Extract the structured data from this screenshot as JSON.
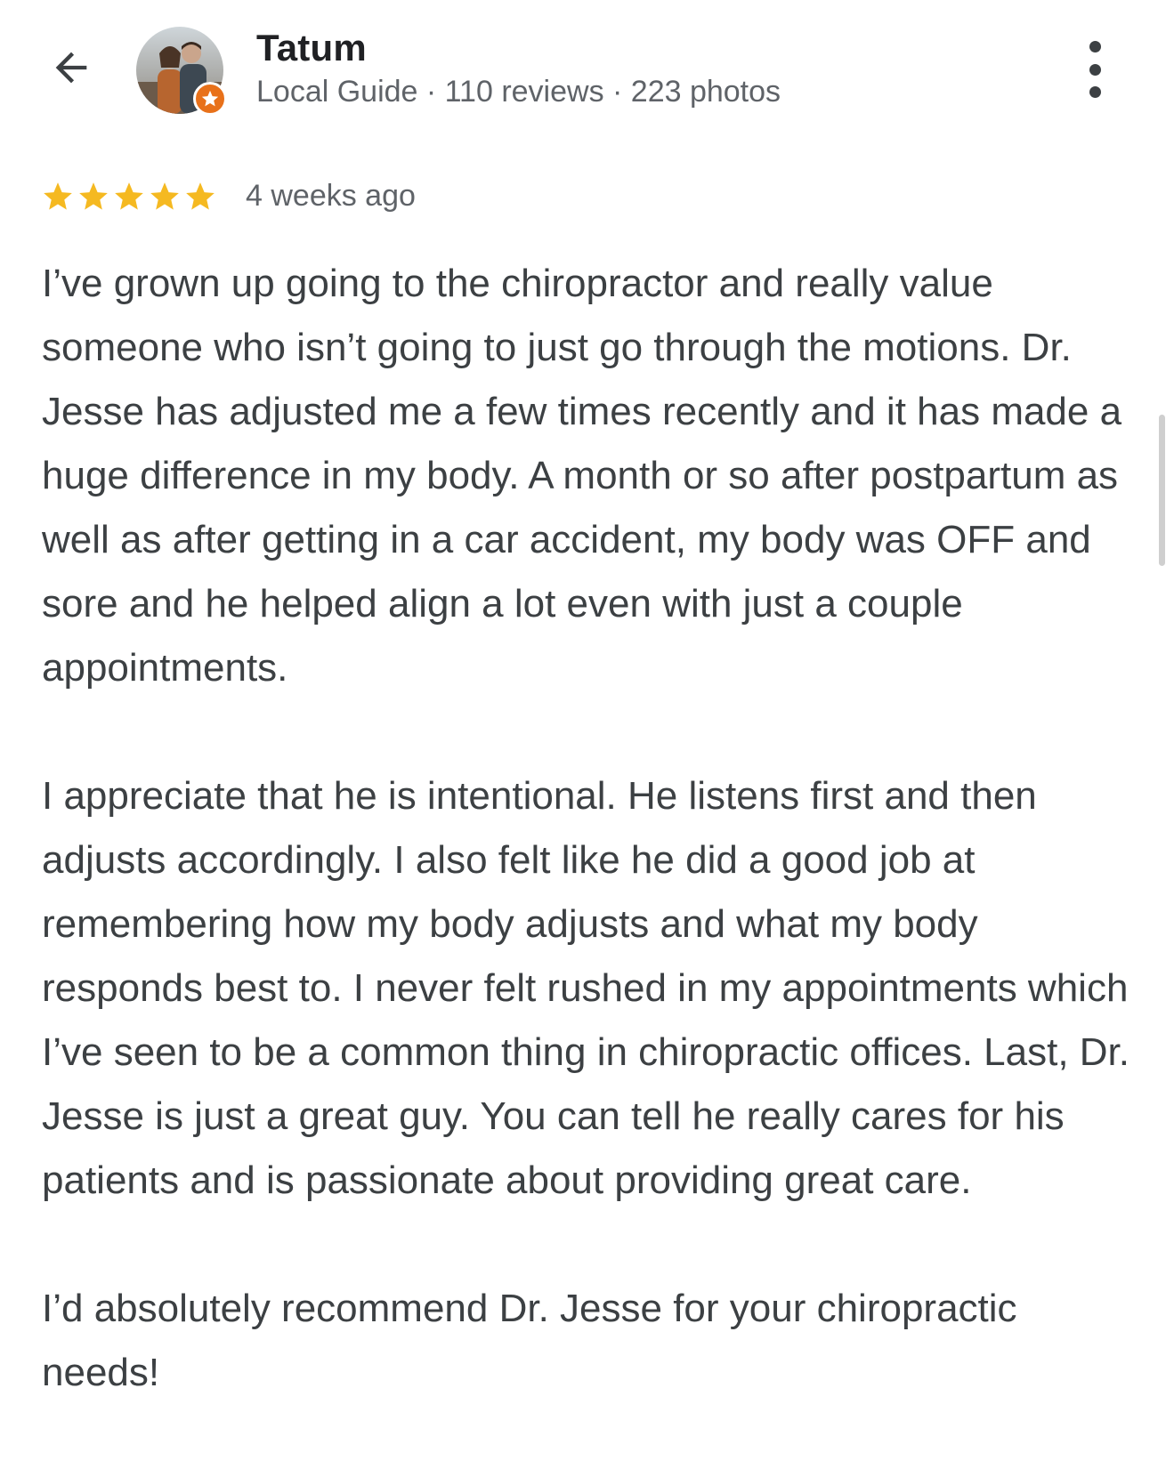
{
  "header": {
    "author_name": "Tatum",
    "author_meta": "Local Guide · 110 reviews · 223 photos",
    "icons": {
      "back": "arrow-back-icon",
      "more": "more-vert-icon",
      "badge": "local-guide-badge-icon"
    }
  },
  "review": {
    "rating": 5,
    "max_rating": 5,
    "time_ago": "4 weeks ago",
    "paragraphs": [
      "I’ve grown up going to the chiropractor and really value someone who isn’t going to just go through the motions. Dr. Jesse has adjusted me a few times recently and it has made a huge difference in my body. A month or so after postpartum as well as after getting in a car accident, my body was OFF and sore and he helped align a lot even with just a couple appointments.",
      "I appreciate that he is intentional. He listens first and then adjusts accordingly. I also felt like he did a good job at remembering how my body adjusts and what my body responds best to. I never felt rushed in my appointments which I’ve seen to be a common thing in chiropractic offices. Last, Dr. Jesse is just a great guy. You can tell he really cares for his patients and is passionate about providing great care.",
      "I’d absolutely recommend Dr. Jesse for your chiropractic needs!"
    ]
  },
  "colors": {
    "star": "#f5b921",
    "badge": "#e8711a",
    "text_primary": "#202124",
    "text_secondary": "#5f6368",
    "body_text": "#3c4043"
  }
}
